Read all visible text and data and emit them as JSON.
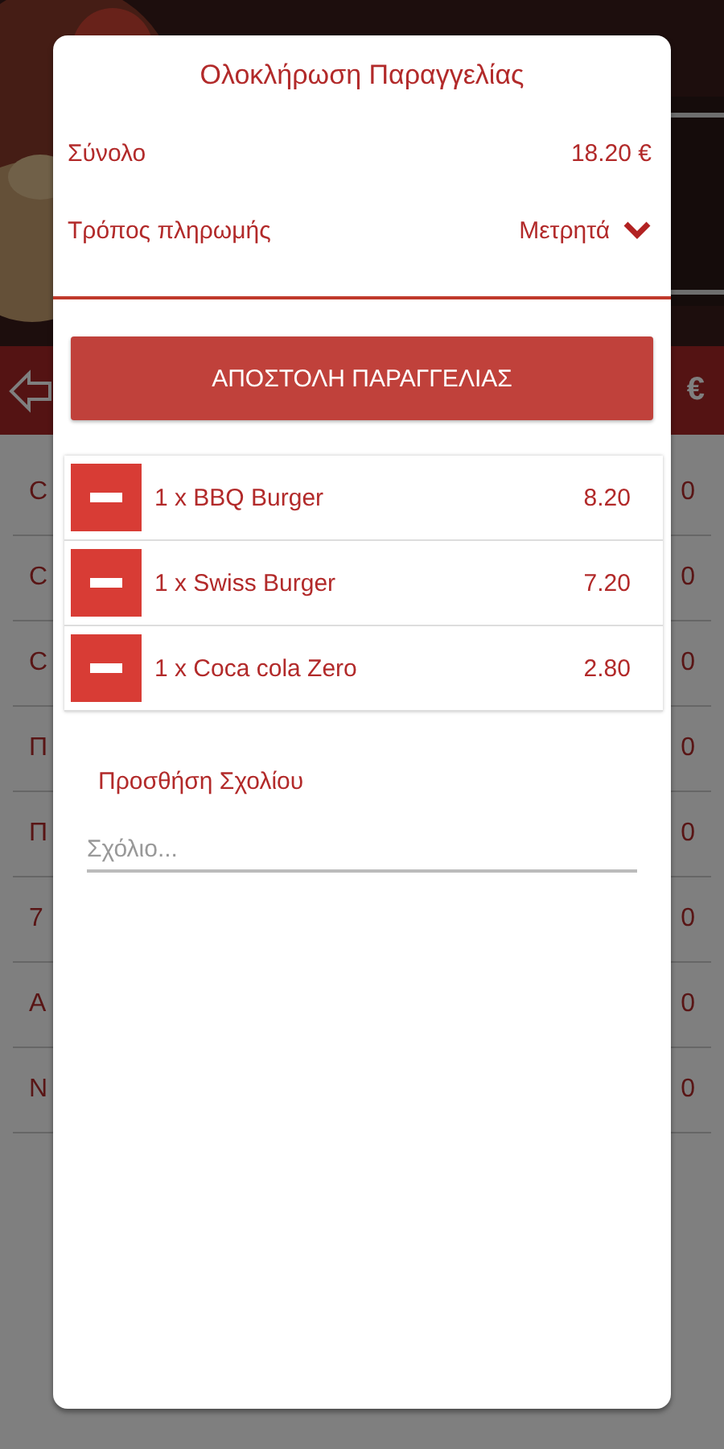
{
  "background": {
    "bar": {
      "price": "€"
    },
    "rows": [
      {
        "name": "C",
        "price": "0"
      },
      {
        "name": "C",
        "price": "0"
      },
      {
        "name": "C",
        "price": "0"
      },
      {
        "name": "Π",
        "price": "0"
      },
      {
        "name": "Π",
        "price": "0"
      },
      {
        "name": "7",
        "price": "0"
      },
      {
        "name": "Α",
        "price": "0"
      },
      {
        "name": "Ν",
        "price": "0"
      }
    ]
  },
  "dialog": {
    "title": "Ολοκλήρωση Παραγγελίας",
    "total": {
      "label": "Σύνολο",
      "value": "18.20 €"
    },
    "payment": {
      "label": "Τρόπος πληρωμής",
      "value": "Μετρητά"
    },
    "submit_button": "ΑΠΟΣΤΟΛΗ ΠΑΡΑΓΓΕΛΙΑΣ",
    "items": [
      {
        "label": "1 x BBQ Burger",
        "price": "8.20"
      },
      {
        "label": "1 x Swiss Burger",
        "price": "7.20"
      },
      {
        "label": "1 x Coca cola Zero",
        "price": "2.80"
      }
    ],
    "comment_link": "Προσθήση Σχολίου",
    "comment_field": {
      "placeholder": "Σχόλιο..."
    }
  }
}
